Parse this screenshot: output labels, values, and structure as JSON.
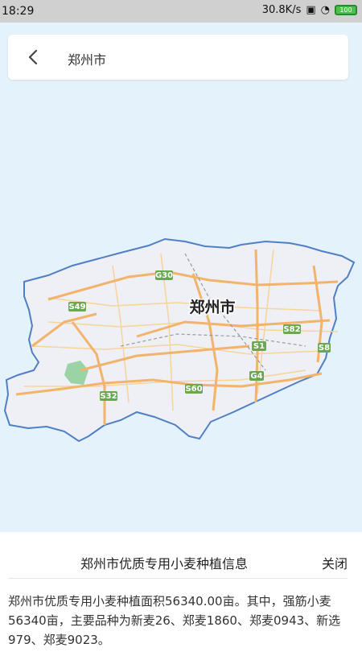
{
  "status_bar": {
    "time": "18:29",
    "net_speed": "30.8K/s",
    "battery_label": "100"
  },
  "search": {
    "back_icon": "chevron-left-icon",
    "value": "郑州市"
  },
  "map": {
    "city_label": "郑州市",
    "road_labels": [
      "G30",
      "S49",
      "S82",
      "S1",
      "G4",
      "S60",
      "S32",
      "S8"
    ],
    "colors": {
      "background": "#e4f2fb",
      "boundary": "#4f7fc4",
      "region_fill": "#eef0f6",
      "road_major": "#f2b36b",
      "road_minor": "#f6d49b",
      "road_sign": "#6aa84f",
      "park": "#9bd3a6"
    }
  },
  "info_panel": {
    "title": "郑州市优质专用小麦种植信息",
    "close_label": "关闭",
    "body": "郑州市优质专用小麦种植面积56340.00亩。其中，强筋小麦56340亩，主要品种为新麦26、郑麦1860、郑麦0943、新选979、郑麦9023。"
  }
}
